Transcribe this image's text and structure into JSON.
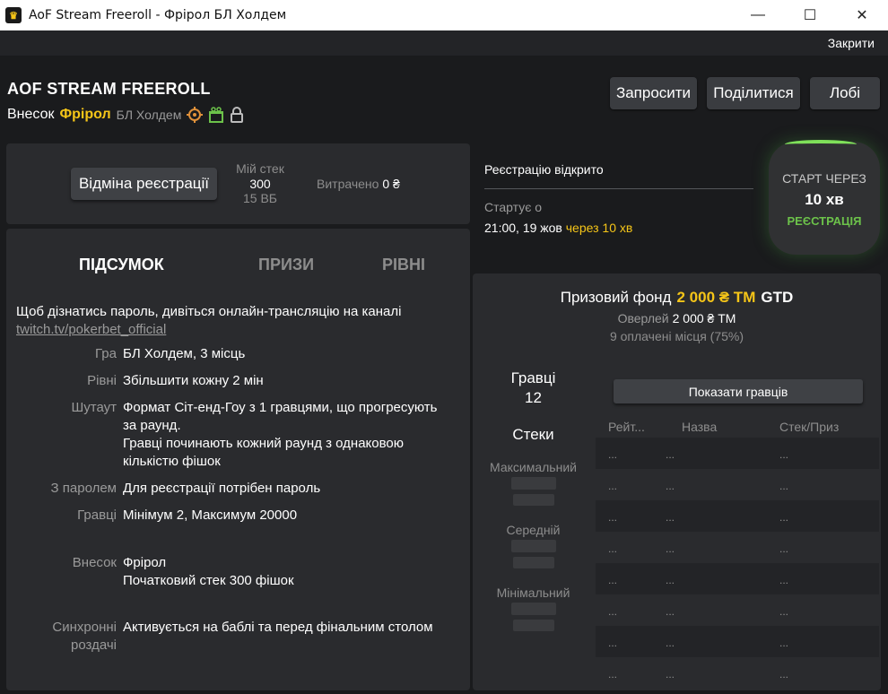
{
  "window": {
    "title": "AoF Stream Freeroll - Фрірол БЛ Холдем",
    "minimize": "—",
    "maximize": "☐",
    "close": "✕"
  },
  "header": {
    "close_link": "Закрити",
    "title": "AOF STREAM FREEROLL",
    "buyin_label": "Внесок",
    "buyin_value": "Фрірол",
    "game": "БЛ Холдем",
    "icons": [
      "target-icon",
      "gift-icon",
      "lock-icon"
    ],
    "buttons": {
      "invite": "Запросити",
      "share": "Поділитися",
      "lobby": "Лобі"
    }
  },
  "registration": {
    "cancel_button": "Відміна реєстрації",
    "my_stack_label": "Мій стек",
    "my_stack_value": "300",
    "my_stack_bb": "15 ВБ",
    "spent_label": "Витрачено",
    "spent_value": "0 ₴"
  },
  "status": {
    "reg_open": "Реєстрацію відкрито",
    "starts_label": "Стартує о",
    "start_time": "21:00, 19 жов",
    "start_in": "через 10 хв"
  },
  "timer": {
    "label": "СТАРТ ЧЕРЕЗ",
    "value": "10 хв",
    "status": "РЕЄСТРАЦІЯ"
  },
  "tabs": [
    {
      "label": "ПІДСУМОК",
      "active": true
    },
    {
      "label": "ПРИЗИ",
      "active": false
    },
    {
      "label": "РІВНІ",
      "active": false
    }
  ],
  "summary": {
    "intro": "Щоб дізнатись пароль, дивіться онлайн-трансляцію на каналі",
    "link": "twitch.tv/pokerbet_official",
    "rows": [
      {
        "label": "Гра",
        "value": "БЛ Холдем, 3 місць"
      },
      {
        "label": "Рівні",
        "value": "Збільшити кожну 2 мін"
      },
      {
        "label": "Шутаут",
        "value1": "Формат Сіт-енд-Гоу з 1 гравцями, що прогресують",
        "value2": "за раунд.",
        "value3": "Гравці починають кожний раунд з однаковою",
        "value4": "кількістю фішок"
      },
      {
        "label": "З паролем",
        "value": "Для реєстрації потрібен пароль"
      },
      {
        "label": "Гравці",
        "value": "Мінімум 2, Максимум 20000"
      },
      {
        "label": "Внесок",
        "value1": "Фрірол",
        "value2": "Початковий стек 300 фішок"
      },
      {
        "label1": "Синхронні",
        "label2": "роздачі",
        "value": "Активується на баблі та перед фінальним столом"
      }
    ]
  },
  "prize": {
    "label": "Призовий фонд",
    "amount": "2 000 ₴ ТМ",
    "gtd": "GTD",
    "overlay_label": "Оверлей",
    "overlay_value": "2 000 ₴ ТМ",
    "paid": "9 оплачені місця (75%)"
  },
  "players": {
    "label": "Гравці",
    "count": "12",
    "show_button": "Показати гравців",
    "stacks_label": "Стеки",
    "max_label": "Максимальний",
    "avg_label": "Середній",
    "min_label": "Мінімальний",
    "columns": [
      "Рейт...",
      "Назва",
      "Стек/Приз"
    ],
    "placeholder": "..."
  }
}
